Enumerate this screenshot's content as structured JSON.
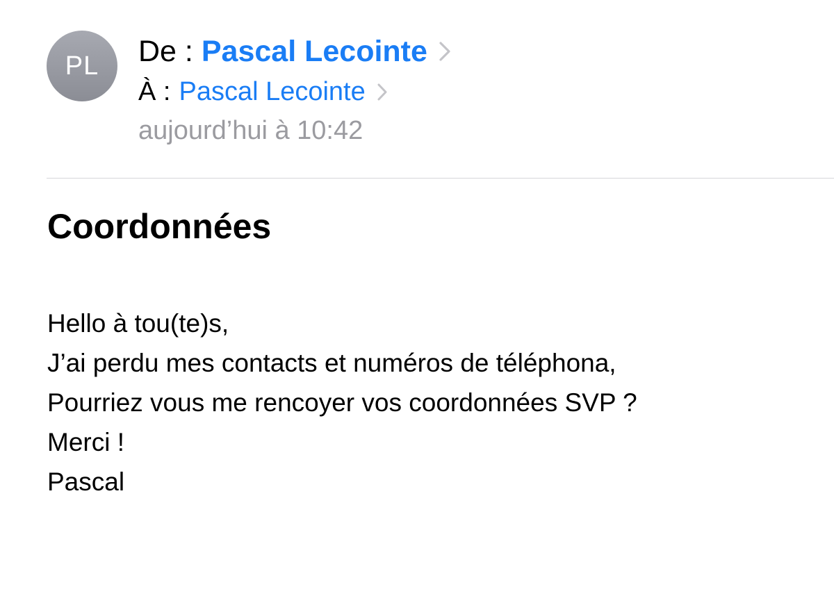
{
  "email": {
    "avatar_initials": "PL",
    "from_label": "De :",
    "from_name": "Pascal Lecointe",
    "to_label": "À :",
    "to_name": "Pascal Lecointe",
    "date": "aujourd’hui à 10:42",
    "subject": "Coordonnées",
    "body_lines": [
      "Hello à tou(te)s,",
      "J’ai perdu mes contacts et numéros de téléphona,",
      "Pourriez vous me rencoyer vos coordonnées SVP ?",
      "Merci !",
      "Pascal"
    ]
  },
  "colors": {
    "link_blue": "#1a7df5",
    "secondary_gray": "#9b9ba0",
    "avatar_gray": "#9a9ca4",
    "divider": "#d6d6d9"
  },
  "icons": {
    "from_chevron": "chevron-right-icon",
    "to_chevron": "chevron-right-icon"
  }
}
